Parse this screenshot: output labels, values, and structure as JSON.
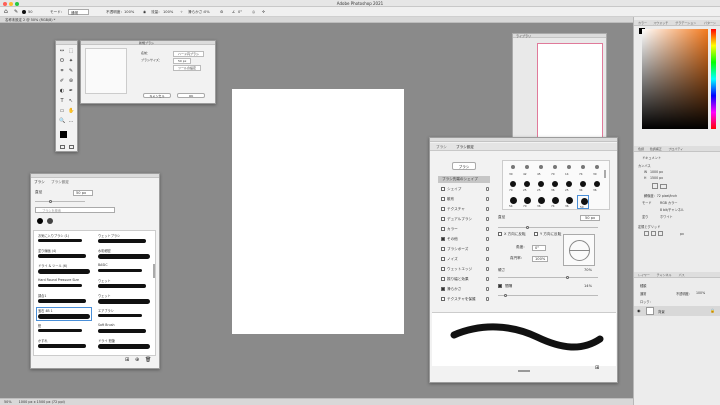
{
  "app": {
    "title": "Adobe Photoshop 2021"
  },
  "options_bar": {
    "home_label": "⌂",
    "brush_size": "50",
    "mode_label": "モード：",
    "mode_value": "通常",
    "opacity_label": "不透明度：",
    "opacity_value": "100%",
    "flow_label": "流量：",
    "flow_value": "100%",
    "smoothing_label": "滑らかさ：",
    "smoothing_value": "0%",
    "angle_value": "0°"
  },
  "document_tab": {
    "label": "名称未設定 2 @ 50% (RGB/8) *"
  },
  "status_bar": {
    "zoom": "50%",
    "info": "1000 px x 1500 px (72 ppi)"
  },
  "toolbox": {
    "tools": [
      "↔",
      "⬚",
      "ʘ",
      "✦",
      "⌗",
      "✎",
      "✐",
      "⊛",
      "◐",
      "✒",
      "T",
      "↖",
      "▭",
      "✋",
      "🔍",
      "…"
    ]
  },
  "dialog": {
    "title": "新規ブラシ",
    "rows": [
      {
        "label": "名前：",
        "value": "ハード円ブラシ"
      },
      {
        "label": "ブラシサイズ：",
        "value": "50 px"
      },
      {
        "label": "",
        "value": "ツールの設定"
      }
    ],
    "ok": "OK",
    "cancel": "キャンセル"
  },
  "library": {
    "title": "ライブラリ"
  },
  "brushes_panel": {
    "tabs": [
      "ブラシ",
      "ブラシ設定"
    ],
    "size_label": "直径",
    "size_value": "50 px",
    "search_placeholder": "ブラシを検索",
    "items": [
      {
        "left": "お気に入りブラシ (1)",
        "right": "ウェットブラシ"
      },
      {
        "left": "塗り線画 (4)",
        "right": "水彩細密"
      },
      {
        "left": "ドライ & ツール (6)",
        "right": "BASIC"
      },
      {
        "left": "Hard Round Pressure Size",
        "right": "ウェット"
      },
      {
        "left": "調合1",
        "right": "ウェット"
      },
      {
        "left": "宝石 4B 1",
        "right": "エアブラシ"
      },
      {
        "left": "鉛",
        "right": "Soft Brush"
      },
      {
        "left": "かすれ",
        "right": "ドライ 鉛筆"
      }
    ]
  },
  "brush_settings": {
    "tabs": [
      "ブラシ",
      "ブラシ設定"
    ],
    "brush_button": "ブラシ",
    "options": [
      {
        "label": "ブラシ先端のシェイプ",
        "checked": false,
        "active": true
      },
      {
        "label": "シェイプ",
        "checked": false
      },
      {
        "label": "散布",
        "checked": false
      },
      {
        "label": "テクスチャ",
        "checked": false
      },
      {
        "label": "デュアルブラシ",
        "checked": false
      },
      {
        "label": "カラー",
        "checked": false
      },
      {
        "label": "その他",
        "checked": true
      },
      {
        "label": "ブラシポーズ",
        "checked": false
      },
      {
        "label": "ノイズ",
        "checked": false
      },
      {
        "label": "ウェットエッジ",
        "checked": false
      },
      {
        "label": "振り幅と効果",
        "checked": false
      },
      {
        "label": "滑らかさ",
        "checked": true
      },
      {
        "label": "テクスチャを保護",
        "checked": false
      }
    ],
    "tip_sizes": [
      "30",
      "42",
      "45",
      "70",
      "14",
      "74",
      "30",
      "70",
      "25",
      "25",
      "36",
      "25",
      "34",
      "36",
      "54",
      "70",
      "36",
      "74",
      "36",
      "50"
    ],
    "size_label": "直径",
    "size_value": "50 px",
    "flip_x": "X 方向に反転",
    "flip_y": "Y 方向に反転",
    "angle_label": "角度：",
    "angle_value": "0°",
    "roundness_label": "真円率：",
    "roundness_value": "100%",
    "hardness_label": "硬さ",
    "hardness_value": "70%",
    "spacing_label": "間隔",
    "spacing_value": "14%"
  },
  "right_panel": {
    "color_tabs": [
      "カラー",
      "スウォッチ",
      "グラデーション",
      "パターン"
    ],
    "props_tabs": [
      "色調",
      "色調補正",
      "プロパティ"
    ],
    "props_title": "ドキュメント",
    "canvas_label": "カンバス",
    "width_label": "W",
    "width_value": "1000 px",
    "height_label": "H",
    "height_value": "1500 px",
    "resolution": "解像度：72 pixel/inch",
    "mode_label": "モード",
    "mode_value": "RGB カラー",
    "bits_value": "8 bit/チャンネル",
    "fill_label": "塗り",
    "fill_value": "ホワイト",
    "guides_label": "定規とグリッド",
    "grid_value": "px",
    "layers_tabs": [
      "レイヤー",
      "チャンネル",
      "パス"
    ],
    "search_label": "種類",
    "blend_value": "通常",
    "opacity_label": "不透明度：",
    "opacity_value": "100%",
    "lock_label": "ロック：",
    "layer_name": "背景"
  },
  "colors": {
    "accent": "#4a8fd8",
    "hue_top": "#f47a1e"
  }
}
